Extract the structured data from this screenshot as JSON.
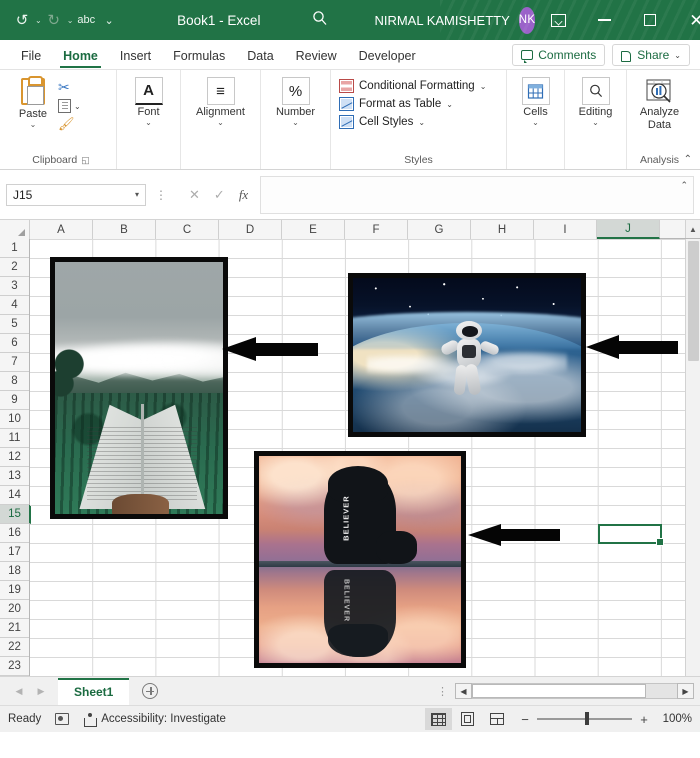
{
  "titlebar": {
    "undo": "↺",
    "redo": "↻",
    "spelling": "abc",
    "customize": "⌄",
    "document_title": "Book1  -  Excel",
    "search_icon": "search-icon",
    "user_name": "NIRMAL KAMISHETTY",
    "avatar_initials": "NK",
    "ribbon_display_options": "ribbon-display-options",
    "minimize": "minimize",
    "maximize": "maximize",
    "close": "✕",
    "bg_color": "#217346"
  },
  "ribbon_tabs": [
    {
      "label": "File",
      "active": false
    },
    {
      "label": "Home",
      "active": true
    },
    {
      "label": "Insert",
      "active": false
    },
    {
      "label": "Formulas",
      "active": false
    },
    {
      "label": "Data",
      "active": false
    },
    {
      "label": "Review",
      "active": false
    },
    {
      "label": "Developer",
      "active": false
    }
  ],
  "tabs_right": {
    "comments": "Comments",
    "share": "Share",
    "share_caret": "⌄"
  },
  "ribbon": {
    "clipboard": {
      "paste_label": "Paste",
      "paste_caret": "⌄",
      "cut_icon": "✂",
      "copy_caret": "⌄",
      "group_label": "Clipboard",
      "dialog_launcher": "◱"
    },
    "font": {
      "icon": "A",
      "label": "Font",
      "caret": "⌄"
    },
    "alignment": {
      "icon": "≡",
      "label": "Alignment",
      "caret": "⌄"
    },
    "number": {
      "icon": "%",
      "label": "Number",
      "caret": "⌄"
    },
    "styles": {
      "conditional_formatting": "Conditional Formatting",
      "format_as_table": "Format as Table",
      "cell_styles": "Cell Styles",
      "caret": "⌄",
      "group_label": "Styles"
    },
    "cells": {
      "label": "Cells",
      "caret": "⌄"
    },
    "editing": {
      "label": "Editing",
      "caret": "⌄",
      "icon": "⌕"
    },
    "analysis": {
      "label_line1": "Analyze",
      "label_line2": "Data",
      "group_label": "Analysis"
    },
    "collapse": "⌃"
  },
  "formula_bar": {
    "name_box_value": "J15",
    "name_box_caret": "▾",
    "cancel_icon": "✕",
    "enter_icon": "✓",
    "function_icon": "fx",
    "formula_value": "",
    "expand_icon": "⌃"
  },
  "grid": {
    "columns": [
      "A",
      "B",
      "C",
      "D",
      "E",
      "F",
      "G",
      "H",
      "I",
      "J"
    ],
    "selected_column": "J",
    "rows": [
      "1",
      "2",
      "3",
      "4",
      "5",
      "6",
      "7",
      "8",
      "9",
      "10",
      "11",
      "12",
      "13",
      "14",
      "15",
      "16",
      "17",
      "18",
      "19",
      "20",
      "21",
      "22",
      "23"
    ],
    "selected_row": "15",
    "selected_cell": "J15",
    "selection_color": "#217346",
    "scroll_up_icon": "▲",
    "objects": [
      {
        "name": "picture-book-forest",
        "description": "Open book held in hands against misty mountain forest landscape",
        "anchor": "A2:C14"
      },
      {
        "name": "picture-astronaut-earth",
        "description": "Astronaut floating in space above planet Earth",
        "anchor": "F3:H9"
      },
      {
        "name": "picture-believer-reflection",
        "description": "Silhouette of person in BELIEVER hoodie sitting with water reflection at sunset",
        "anchor": "D11:G21",
        "overlay_text": "BELIEVER"
      },
      {
        "name": "arrow-shape-left-1",
        "description": "Black left-pointing arrow beside book picture"
      },
      {
        "name": "arrow-shape-left-2",
        "description": "Black left-pointing arrow beside astronaut picture"
      },
      {
        "name": "arrow-shape-left-3",
        "description": "Black left-pointing arrow beside believer picture"
      }
    ]
  },
  "sheet_bar": {
    "prev_icon": "◀",
    "next_icon": "▶",
    "sheets": [
      "Sheet1"
    ],
    "active_sheet": "Sheet1",
    "add_sheet": "+",
    "split_handle": "⋮",
    "hscroll_left": "◀",
    "hscroll_right": "▶"
  },
  "status_bar": {
    "state": "Ready",
    "macro_record_icon": "macro-record-icon",
    "accessibility": "Accessibility: Investigate",
    "views": [
      {
        "name": "normal-view",
        "active": true
      },
      {
        "name": "page-layout-view",
        "active": false
      },
      {
        "name": "page-break-preview",
        "active": false
      }
    ],
    "zoom_out": "−",
    "zoom_in": "+",
    "zoom_level": "100%"
  }
}
